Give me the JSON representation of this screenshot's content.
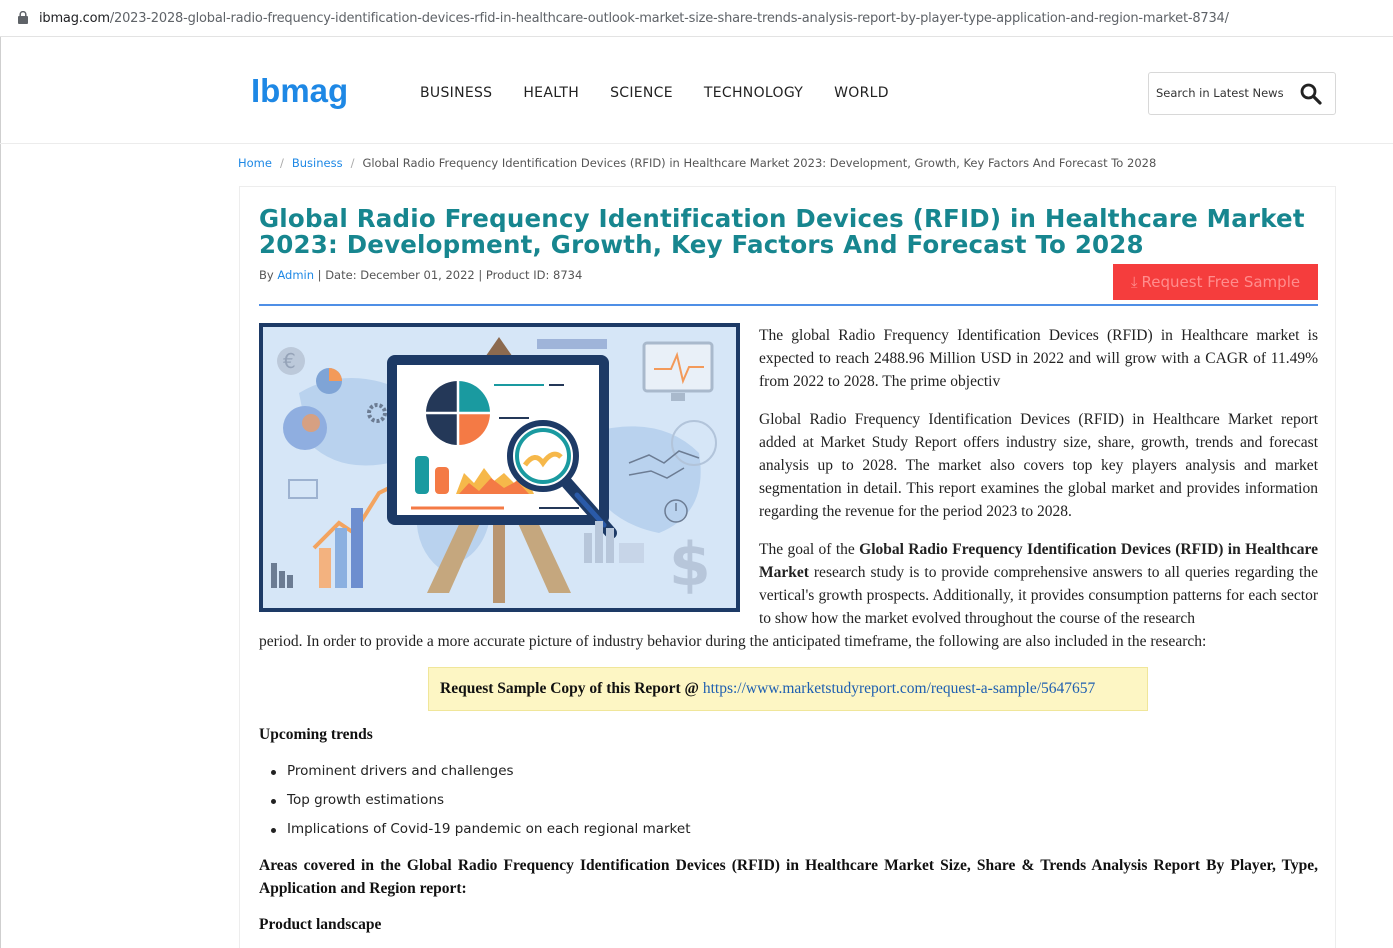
{
  "browser": {
    "url_domain": "ibmag.com",
    "url_path": "/2023-2028-global-radio-frequency-identification-devices-rfid-in-healthcare-outlook-market-size-share-trends-analysis-report-by-player-type-application-and-region-market-8734/"
  },
  "header": {
    "logo": "Ibmag",
    "nav": [
      "BUSINESS",
      "HEALTH",
      "SCIENCE",
      "TECHNOLOGY",
      "WORLD"
    ],
    "search_placeholder": "Search in Latest News"
  },
  "breadcrumb": {
    "home": "Home",
    "section": "Business",
    "current": "Global Radio Frequency Identification Devices (RFID) in Healthcare Market 2023: Development, Growth, Key Factors And Forecast To 2028"
  },
  "article": {
    "title": "Global Radio Frequency Identification Devices (RFID) in Healthcare Market 2023: Development, Growth, Key Factors And Forecast To 2028",
    "by_label": "By",
    "author": "Admin",
    "meta_rest": "| Date: December 01, 2022 | Product ID: 8734",
    "request_button": "Request Free Sample",
    "para1": "The global Radio Frequency Identification Devices (RFID) in Healthcare market is expected to reach 2488.96 Million USD in 2022 and will grow with a CAGR of 11.49% from 2022 to 2028. The prime objectiv",
    "para2": "Global Radio Frequency Identification Devices (RFID) in Healthcare Market report added at Market Study Report offers industry size, share, growth, trends and forecast analysis up to 2028. The market also covers top key players analysis and market segmentation in detail. This report examines the global market and provides information regarding the revenue for the period 2023 to 2028.",
    "para3_pre": "The goal of the ",
    "para3_bold": "Global Radio Frequency Identification Devices (RFID) in Healthcare Market",
    "para3_post": " research study is to provide comprehensive answers to all queries regarding the vertical's growth prospects. Additionally, it provides consumption patterns for each sector to show how the market evolved throughout the course of the research",
    "para3_cont": "period. In order to provide a more accurate picture of industry behavior during the anticipated timeframe, the following are also included in the research:",
    "sample_label": "Request Sample Copy of this Report @",
    "sample_link": "https://www.marketstudyreport.com/request-a-sample/5647657",
    "trends_heading": "Upcoming trends",
    "trends": [
      "Prominent drivers and challenges",
      "Top growth estimations",
      "Implications of Covid-19 pandemic on each regional market"
    ],
    "areas_heading": "Areas covered in the Global Radio Frequency Identification Devices (RFID) in Healthcare Market Size, Share & Trends Analysis Report By Player, Type, Application and Region report:",
    "product_heading": "Product landscape"
  },
  "colors": {
    "logo": "#1e88e5",
    "title": "#17868f",
    "button": "#f53d3d",
    "rule": "#4f8fe6",
    "sample_bg": "#fdf6c4"
  }
}
